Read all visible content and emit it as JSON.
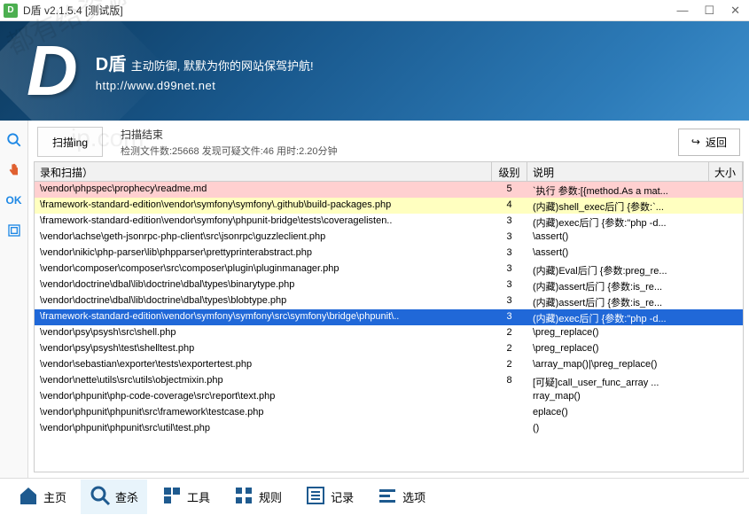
{
  "titlebar": {
    "title": "D盾 v2.1.5.4 [测试版]",
    "icon_letter": "D"
  },
  "banner": {
    "name": "D盾",
    "tagline": "主动防御, 默默为你的网站保驾护航!",
    "url": "http://www.d99net.net"
  },
  "left_rail": [
    {
      "icon": "search",
      "color": "#1e88e5"
    },
    {
      "icon": "hand",
      "color": "#e06030"
    },
    {
      "icon": "ok",
      "color": "#1e88e5",
      "text": "OK"
    },
    {
      "icon": "box",
      "color": "#1e88e5"
    }
  ],
  "scan": {
    "button": "扫描ing",
    "result_title": "扫描结束",
    "stats": "检测文件数:25668 发现可疑文件:46 用时:2.20分钟",
    "back": "返回"
  },
  "columns": {
    "path": "录和扫描）",
    "level": "级别",
    "desc": "说明",
    "size": "大小"
  },
  "rows": [
    {
      "path": "\\vendor\\phpspec\\prophecy\\readme.md",
      "level": 5,
      "desc": "`执行 参数:[{method.As a mat...",
      "sel": false
    },
    {
      "path": "\\framework-standard-edition\\vendor\\symfony\\symfony\\.github\\build-packages.php",
      "level": 4,
      "desc": "(内藏)shell_exec后门 {参数:`...",
      "sel": false
    },
    {
      "path": "\\framework-standard-edition\\vendor\\symfony\\phpunit-bridge\\tests\\coveragelisten..",
      "level": 3,
      "desc": "(内藏)exec后门 {参数:\"php -d...",
      "sel": false
    },
    {
      "path": "\\vendor\\achse\\geth-jsonrpc-php-client\\src\\jsonrpc\\guzzleclient.php",
      "level": 3,
      "desc": "\\assert()",
      "sel": false
    },
    {
      "path": "\\vendor\\nikic\\php-parser\\lib\\phpparser\\prettyprinterabstract.php",
      "level": 3,
      "desc": "\\assert()",
      "sel": false
    },
    {
      "path": "\\vendor\\composer\\composer\\src\\composer\\plugin\\pluginmanager.php",
      "level": 3,
      "desc": "(内藏)Eval后门 {参数:preg_re...",
      "sel": false
    },
    {
      "path": "\\vendor\\doctrine\\dbal\\lib\\doctrine\\dbal\\types\\binarytype.php",
      "level": 3,
      "desc": "(内藏)assert后门 {参数:is_re...",
      "sel": false
    },
    {
      "path": "\\vendor\\doctrine\\dbal\\lib\\doctrine\\dbal\\types\\blobtype.php",
      "level": 3,
      "desc": "(内藏)assert后门 {参数:is_re...",
      "sel": false
    },
    {
      "path": "\\framework-standard-edition\\vendor\\symfony\\symfony\\src\\symfony\\bridge\\phpunit\\..",
      "level": 3,
      "desc": "(内藏)exec后门 {参数:\"php -d...",
      "sel": true
    },
    {
      "path": "\\vendor\\psy\\psysh\\src\\shell.php",
      "level": 2,
      "desc": "\\preg_replace()",
      "sel": false
    },
    {
      "path": "\\vendor\\psy\\psysh\\test\\shelltest.php",
      "level": 2,
      "desc": "\\preg_replace()",
      "sel": false
    },
    {
      "path": "\\vendor\\sebastian\\exporter\\tests\\exportertest.php",
      "level": 2,
      "desc": "\\array_map()|\\preg_replace()",
      "sel": false
    },
    {
      "path": "\\vendor\\nette\\utils\\src\\utils\\objectmixin.php",
      "level": 8,
      "desc": "[可疑]call_user_func_array ...",
      "sel": false
    },
    {
      "path": "\\vendor\\phpunit\\php-code-coverage\\src\\report\\text.php",
      "level": "",
      "desc": "rray_map()",
      "sel": false
    },
    {
      "path": "\\vendor\\phpunit\\phpunit\\src\\framework\\testcase.php",
      "level": "",
      "desc": "eplace()",
      "sel": false
    },
    {
      "path": "\\vendor\\phpunit\\phpunit\\src\\util\\test.php",
      "level": "",
      "desc": "()",
      "sel": false
    },
    {
      "path": "",
      "level": "",
      "desc": "",
      "sel": false
    }
  ],
  "tabs": [
    {
      "label": "主页",
      "icon": "home",
      "active": false
    },
    {
      "label": "查杀",
      "icon": "search",
      "active": true
    },
    {
      "label": "工具",
      "icon": "tools",
      "active": false
    },
    {
      "label": "规则",
      "icon": "grid",
      "active": false
    },
    {
      "label": "记录",
      "icon": "list",
      "active": false
    },
    {
      "label": "选项",
      "icon": "options",
      "active": false
    }
  ]
}
